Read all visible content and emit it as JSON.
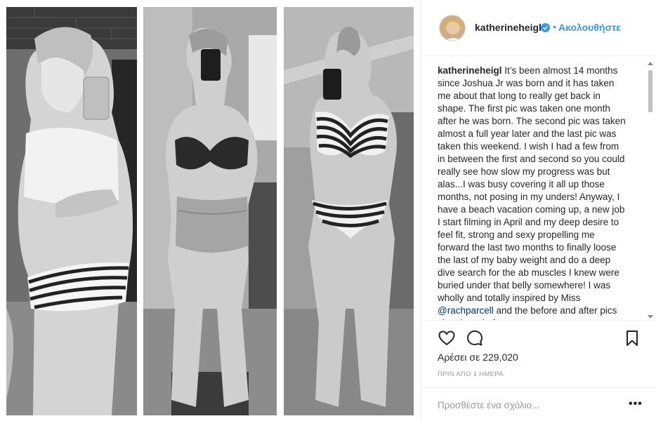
{
  "post": {
    "username": "katherineheigl",
    "follow_label": "Ακολουθήστε",
    "follow_separator": "•",
    "caption_user": "katherineheigl",
    "caption_text_1": " It’s been almost 14 months since Joshua Jr was born and it has taken me about that long to really get back in shape. The first pic was taken one month after he was born. The second pic was taken almost a full year later and the last pic was taken this weekend. I wish I had a few from in between the first and second so you could really see how slow my progress was but alas...I was busy covering it all up those months, not posing in my unders! Anyway, I have a beach vacation coming up, a new job I start filming in April and my deep desire to feel fit, strong and sexy propelling me forward the last two months to finally loose the last of my baby weight and do a deep dive search for the ab muscles I knew were buried under that belly somewhere! I was wholly and totally inspired by Miss ",
    "caption_mention": "@rachparcell",
    "caption_text_2": " and the before and after pics she shared after",
    "likes_text": "Αρέσει σε 229,020",
    "time_ago": "ΠΡΙΝ ΑΠΟ 1 ΗΜΕΡΑ",
    "comment_placeholder": "Προσθέστε ένα σχόλιο...",
    "more_label": "•••"
  },
  "icons": {
    "like": "heart-outline-icon",
    "comment": "speech-bubble-icon",
    "save": "bookmark-icon",
    "verified": "verified-badge-icon",
    "options": "more-options-icon"
  },
  "colors": {
    "link_blue": "#3897f0",
    "mention_blue": "#003569",
    "text": "#262626",
    "muted": "#999999",
    "border": "#efefef"
  }
}
